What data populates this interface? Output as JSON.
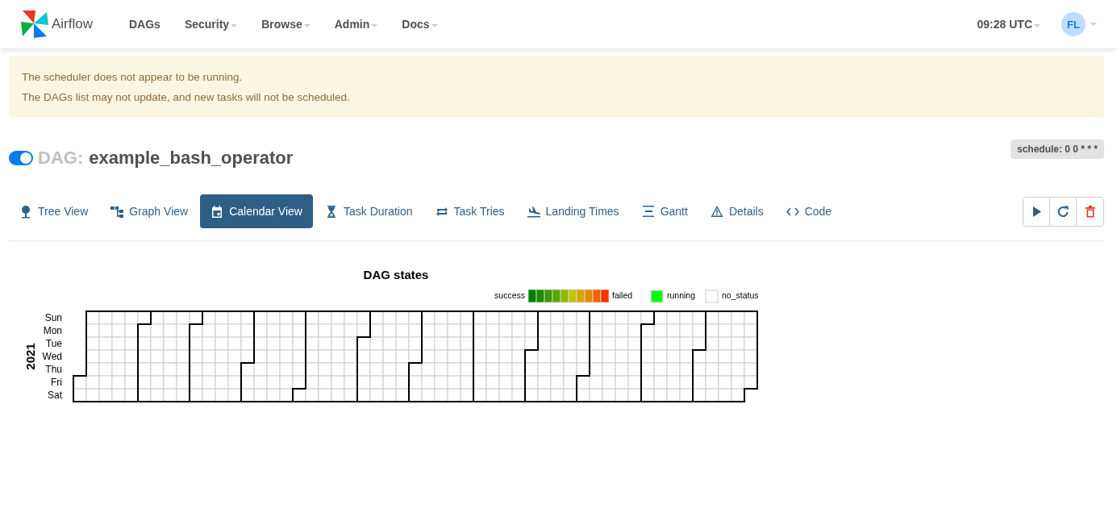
{
  "navbar": {
    "brand": "Airflow",
    "items": [
      {
        "label": "DAGs",
        "has_menu": false
      },
      {
        "label": "Security",
        "has_menu": true
      },
      {
        "label": "Browse",
        "has_menu": true
      },
      {
        "label": "Admin",
        "has_menu": true
      },
      {
        "label": "Docs",
        "has_menu": true
      }
    ],
    "clock": {
      "label": "09:28 UTC",
      "has_menu": true
    },
    "user": {
      "initials": "FL",
      "has_menu": true
    }
  },
  "alert": {
    "lines": [
      "The scheduler does not appear to be running.",
      "The DAGs list may not update, and new tasks will not be scheduled."
    ]
  },
  "dag": {
    "on": true,
    "prefix": "DAG:",
    "name": "example_bash_operator",
    "schedule": "schedule: 0 0 * * *"
  },
  "tabs": [
    {
      "kind": "tree",
      "label": "Tree View",
      "selected": false
    },
    {
      "kind": "graph",
      "label": "Graph View",
      "selected": false
    },
    {
      "kind": "calendar",
      "label": "Calendar View",
      "selected": true
    },
    {
      "kind": "duration",
      "label": "Task Duration",
      "selected": false
    },
    {
      "kind": "tries",
      "label": "Task Tries",
      "selected": false
    },
    {
      "kind": "landing",
      "label": "Landing Times",
      "selected": false
    },
    {
      "kind": "gantt",
      "label": "Gantt",
      "selected": false
    },
    {
      "kind": "details",
      "label": "Details",
      "selected": false
    },
    {
      "kind": "code",
      "label": "Code",
      "selected": false
    }
  ],
  "actions": [
    {
      "kind": "trigger"
    },
    {
      "kind": "refresh"
    },
    {
      "kind": "delete"
    }
  ],
  "calendar": {
    "title": "DAG states",
    "legend": {
      "low_label": "success",
      "high_label": "failed",
      "states": [
        {
          "label": "running",
          "color": "#00ff00"
        },
        {
          "label": "no_status",
          "color": "#ffffff"
        }
      ]
    },
    "year": "2021",
    "day_labels": [
      "Sun",
      "Mon",
      "Tue",
      "Wed",
      "Thu",
      "Fri",
      "Sat"
    ]
  }
}
